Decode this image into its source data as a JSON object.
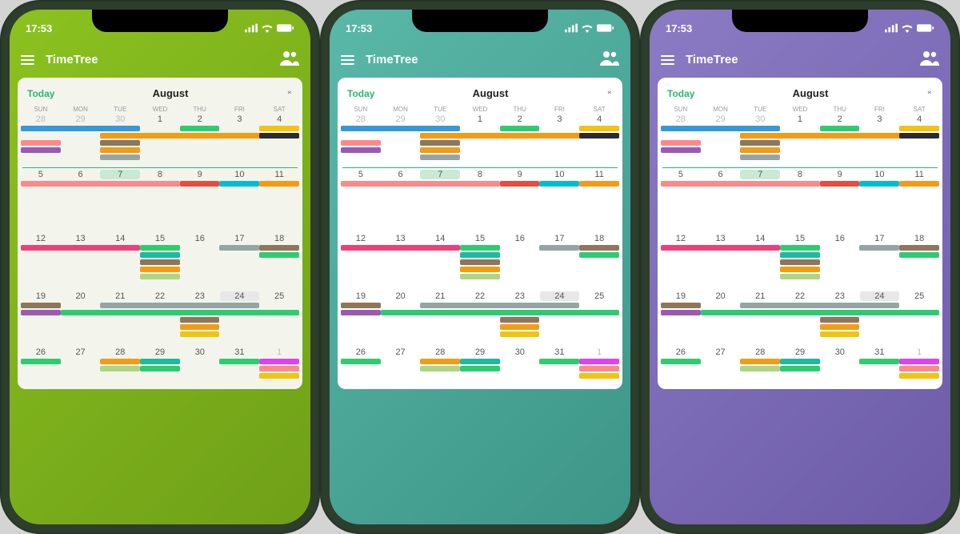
{
  "status": {
    "time": "17:53"
  },
  "app": {
    "title": "TimeTree"
  },
  "calendar": {
    "today_label": "Today",
    "month": "August",
    "weekdays": [
      "SUN",
      "MON",
      "TUE",
      "WED",
      "THU",
      "FRI",
      "SAT"
    ],
    "weeks": [
      {
        "dates": [
          "28",
          "29",
          "30",
          "1",
          "2",
          "3",
          "4"
        ],
        "dim": [
          0,
          1,
          2
        ],
        "today": null,
        "hl": null
      },
      {
        "dates": [
          "5",
          "6",
          "7",
          "8",
          "9",
          "10",
          "11"
        ],
        "dim": [],
        "today": 2,
        "hl": null
      },
      {
        "dates": [
          "12",
          "13",
          "14",
          "15",
          "16",
          "17",
          "18"
        ],
        "dim": [],
        "today": null,
        "hl": null
      },
      {
        "dates": [
          "19",
          "20",
          "21",
          "22",
          "23",
          "24",
          "25"
        ],
        "dim": [],
        "today": null,
        "hl": 5
      },
      {
        "dates": [
          "26",
          "27",
          "28",
          "29",
          "30",
          "31",
          "1"
        ],
        "dim": [
          6
        ],
        "today": null,
        "hl": null
      }
    ]
  },
  "colors": {
    "accent": "#2bb673",
    "blue": "#3498db",
    "orange": "#f39c12",
    "green": "#2ecc71",
    "red": "#e74c3c",
    "purple": "#9b59b6",
    "brown": "#8d7659",
    "yellow": "#f1c40f",
    "teal": "#1abc9c",
    "cyan": "#00bcd4",
    "pink": "#ec407a",
    "grey": "#95a5a6",
    "black": "#2c2c2c",
    "lime": "#aed581",
    "magenta": "#e040fb"
  },
  "themes": [
    {
      "id": "green",
      "bg": "bg-green",
      "card": "card-green"
    },
    {
      "id": "teal",
      "bg": "bg-teal",
      "card": ""
    },
    {
      "id": "purple",
      "bg": "bg-purple",
      "card": ""
    }
  ],
  "events": {
    "week0": [
      {
        "col": 0,
        "row": 0,
        "span": 3,
        "color": "blue"
      },
      {
        "col": 4,
        "row": 0,
        "span": 1,
        "color": "green"
      },
      {
        "col": 6,
        "row": 0,
        "span": 1,
        "color": "yellow"
      },
      {
        "col": 2,
        "row": 1,
        "span": 5,
        "color": "orange"
      },
      {
        "col": 6,
        "row": 1,
        "span": 1,
        "color": "black"
      },
      {
        "col": 0,
        "row": 2,
        "span": 1,
        "color": "coral"
      },
      {
        "col": 2,
        "row": 2,
        "span": 1,
        "color": "brown"
      },
      {
        "col": 0,
        "row": 3,
        "span": 1,
        "color": "purple"
      },
      {
        "col": 2,
        "row": 3,
        "span": 1,
        "color": "orange"
      },
      {
        "col": 2,
        "row": 4,
        "span": 1,
        "color": "grey"
      }
    ],
    "week1": [
      {
        "col": 0,
        "row": 0,
        "span": 4,
        "color": "coral"
      },
      {
        "col": 4,
        "row": 0,
        "span": 1,
        "color": "red"
      },
      {
        "col": 5,
        "row": 0,
        "span": 1,
        "color": "cyan"
      },
      {
        "col": 6,
        "row": 0,
        "span": 1,
        "color": "orange"
      }
    ],
    "week2": [
      {
        "col": 0,
        "row": 0,
        "span": 3,
        "color": "pink"
      },
      {
        "col": 3,
        "row": 0,
        "span": 1,
        "color": "green"
      },
      {
        "col": 5,
        "row": 0,
        "span": 1,
        "color": "grey"
      },
      {
        "col": 6,
        "row": 0,
        "span": 1,
        "color": "brown"
      },
      {
        "col": 3,
        "row": 1,
        "span": 1,
        "color": "teal"
      },
      {
        "col": 6,
        "row": 1,
        "span": 1,
        "color": "green"
      },
      {
        "col": 3,
        "row": 2,
        "span": 1,
        "color": "brown"
      },
      {
        "col": 3,
        "row": 3,
        "span": 1,
        "color": "orange"
      },
      {
        "col": 3,
        "row": 4,
        "span": 1,
        "color": "lime"
      }
    ],
    "week3": [
      {
        "col": 0,
        "row": 0,
        "span": 1,
        "color": "brown"
      },
      {
        "col": 2,
        "row": 0,
        "span": 4,
        "color": "grey"
      },
      {
        "col": 0,
        "row": 1,
        "span": 1,
        "color": "purple"
      },
      {
        "col": 1,
        "row": 1,
        "span": 6,
        "color": "green"
      },
      {
        "col": 4,
        "row": 2,
        "span": 1,
        "color": "brown"
      },
      {
        "col": 4,
        "row": 3,
        "span": 1,
        "color": "orange"
      },
      {
        "col": 4,
        "row": 4,
        "span": 1,
        "color": "yellow"
      }
    ],
    "week4": [
      {
        "col": 0,
        "row": 0,
        "span": 1,
        "color": "green"
      },
      {
        "col": 2,
        "row": 0,
        "span": 1,
        "color": "orange"
      },
      {
        "col": 3,
        "row": 0,
        "span": 1,
        "color": "teal"
      },
      {
        "col": 5,
        "row": 0,
        "span": 1,
        "color": "green"
      },
      {
        "col": 6,
        "row": 0,
        "span": 1,
        "color": "magenta"
      },
      {
        "col": 2,
        "row": 1,
        "span": 1,
        "color": "lime"
      },
      {
        "col": 3,
        "row": 1,
        "span": 1,
        "color": "green"
      },
      {
        "col": 6,
        "row": 1,
        "span": 1,
        "color": "coral"
      },
      {
        "col": 6,
        "row": 2,
        "span": 1,
        "color": "yellow"
      }
    ]
  }
}
